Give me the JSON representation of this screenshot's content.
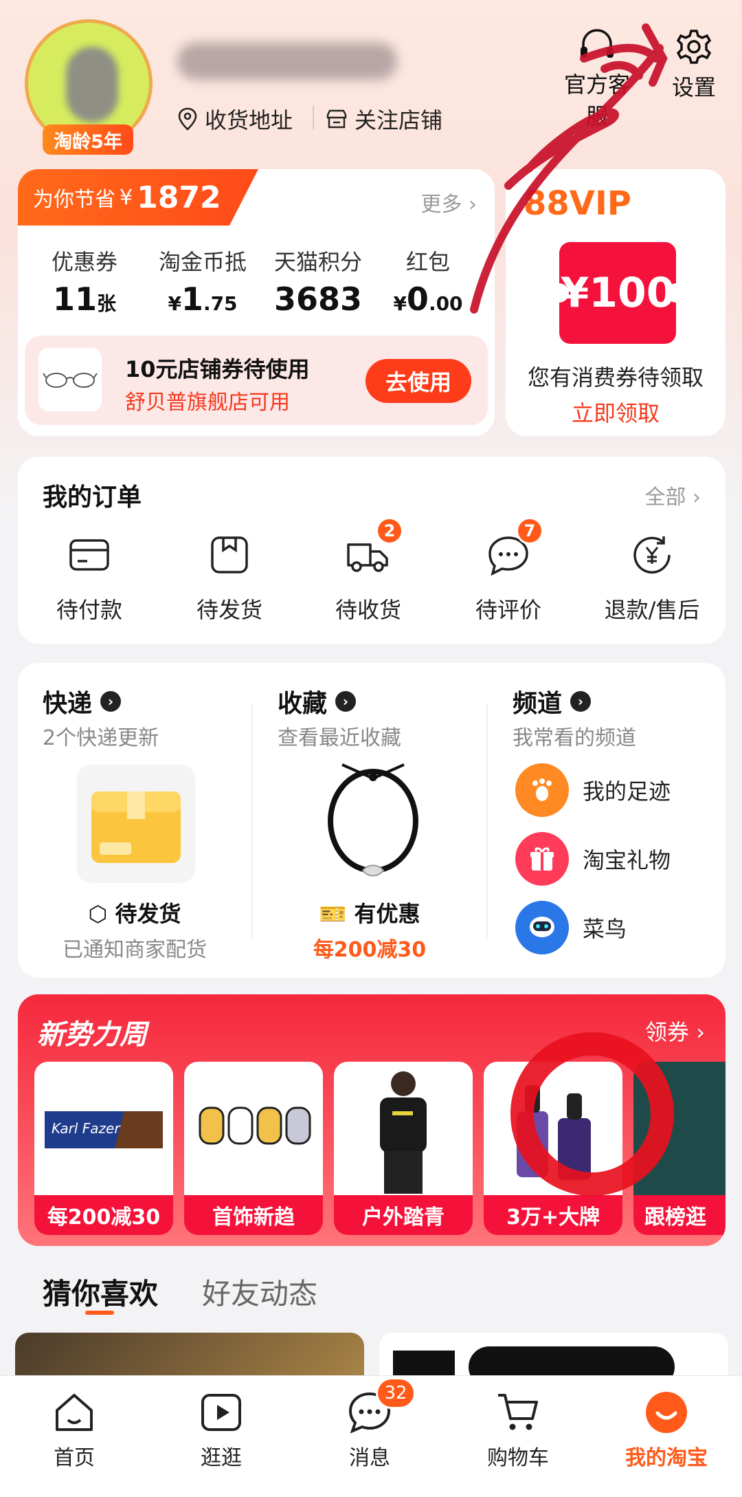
{
  "header": {
    "account_age_badge": "淘龄5年",
    "address_label": "收货地址",
    "follow_label": "关注店铺",
    "service_label": "官方客服",
    "settings_label": "设置"
  },
  "savings": {
    "prefix": "为你节省",
    "currency": "¥",
    "amount": "1872",
    "more_label": "更多",
    "stats": [
      {
        "label": "优惠券",
        "value_main": "11",
        "value_small": "张",
        "prefix": ""
      },
      {
        "label": "淘金币抵",
        "value_main": "1",
        "value_small": ".75",
        "prefix": "¥"
      },
      {
        "label": "天猫积分",
        "value_main": "3683",
        "value_small": "",
        "prefix": ""
      },
      {
        "label": "红包",
        "value_main": "0",
        "value_small": ".00",
        "prefix": "¥"
      }
    ],
    "coupon": {
      "title": "10元店铺券待使用",
      "subtitle": "舒贝普旗舰店可用",
      "button": "去使用"
    }
  },
  "vip": {
    "title": "88VIP",
    "ticket": "¥100",
    "text": "您有消费券待领取",
    "link": "立即领取"
  },
  "orders": {
    "title": "我的订单",
    "all_label": "全部",
    "items": [
      {
        "label": "待付款",
        "badge": ""
      },
      {
        "label": "待发货",
        "badge": ""
      },
      {
        "label": "待收货",
        "badge": "2"
      },
      {
        "label": "待评价",
        "badge": "7"
      },
      {
        "label": "退款/售后",
        "badge": ""
      }
    ]
  },
  "express": {
    "title": "快递",
    "subtitle": "2个快递更新",
    "status": "待发货",
    "note": "已通知商家配货"
  },
  "favorites": {
    "title": "收藏",
    "subtitle": "查看最近收藏",
    "status": "有优惠",
    "note": "每200减30"
  },
  "channels": {
    "title": "频道",
    "subtitle": "我常看的频道",
    "items": [
      "我的足迹",
      "淘宝礼物",
      "菜鸟"
    ]
  },
  "promo": {
    "logo": "新势力周",
    "more": "领券",
    "cards": [
      "每200减30",
      "首饰新趋",
      "户外踏青",
      "3万+大牌",
      "跟榜逛"
    ]
  },
  "feed_tabs": {
    "active": "猜你喜欢",
    "other": "好友动态"
  },
  "bottom_nav": {
    "items": [
      "首页",
      "逛逛",
      "消息",
      "购物车",
      "我的淘宝"
    ],
    "message_badge": "32"
  },
  "colors": {
    "accent": "#ff5a1a",
    "red": "#f5123a"
  }
}
